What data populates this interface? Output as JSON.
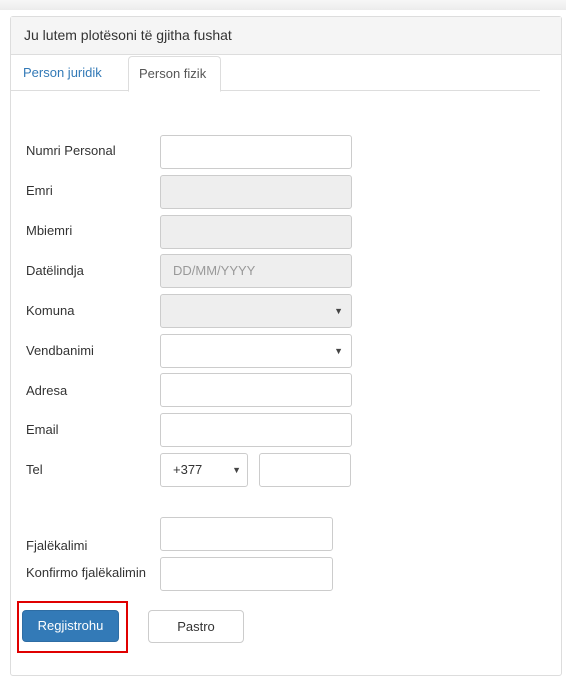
{
  "panel": {
    "heading": "Ju lutem plotësoni të gjitha fushat"
  },
  "tabs": [
    {
      "label": "Person juridik",
      "active": false
    },
    {
      "label": "Person fizik",
      "active": true
    }
  ],
  "form": {
    "personal_number_label": "Numri Personal",
    "name_label": "Emri",
    "surname_label": "Mbiemri",
    "birthdate_label": "Datëlindja",
    "birthdate_placeholder": "DD/MM/YYYY",
    "municipality_label": "Komuna",
    "residence_label": "Vendbanimi",
    "address_label": "Adresa",
    "email_label": "Email",
    "tel_label": "Tel",
    "tel_prefix": "+377",
    "password_label": "Fjalëkalimi",
    "confirm_password_label": "Konfirmo fjalëkalimin"
  },
  "buttons": {
    "register": "Regjistrohu",
    "clear": "Pastro"
  },
  "colors": {
    "primary": "#337ab7",
    "highlight": "#e00000",
    "disabled_bg": "#eeeeee"
  }
}
